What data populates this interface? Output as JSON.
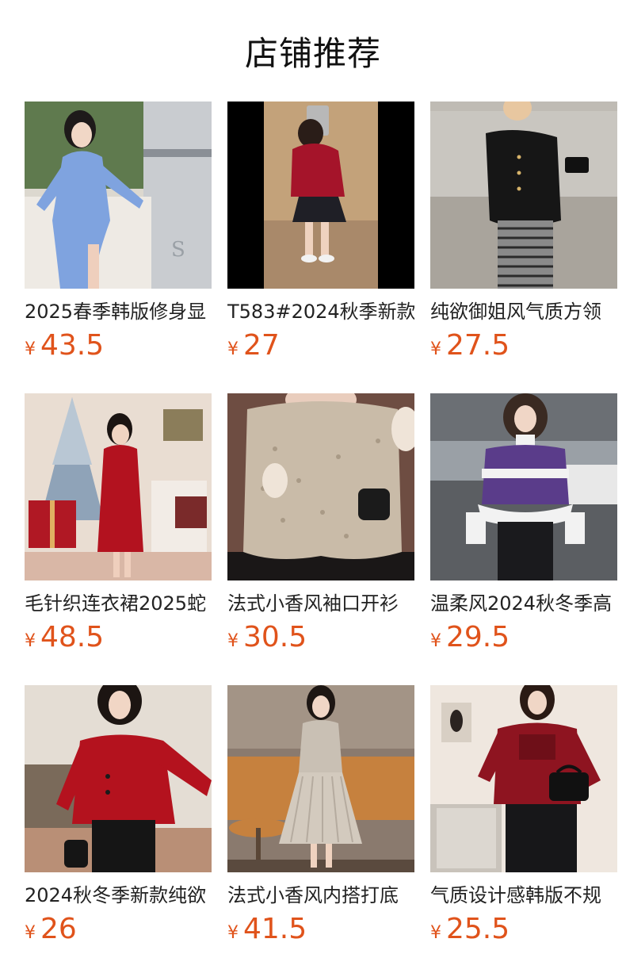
{
  "page": {
    "title": "店铺推荐",
    "currency_symbol": "¥",
    "accent_color": "#e0531b"
  },
  "products": [
    {
      "name": "2025春季韩版修身显",
      "price": "43.5",
      "image": "blue-knit-dress-photo"
    },
    {
      "name": "T583#2024秋季新款",
      "price": "27",
      "image": "red-sweater-mirror-selfie-photo"
    },
    {
      "name": "纯欲御姐风气质方领",
      "price": "27.5",
      "image": "black-cardigan-striped-pants-photo"
    },
    {
      "name": "毛针织连衣裙2025蛇",
      "price": "48.5",
      "image": "red-knit-dress-christmas-tree-photo"
    },
    {
      "name": "法式小香风袖口开衫",
      "price": "30.5",
      "image": "beige-fuzzy-cardigan-photo"
    },
    {
      "name": "温柔风2024秋冬季高",
      "price": "29.5",
      "image": "purple-white-sweater-snow-photo"
    },
    {
      "name": "2024秋冬季新款纯欲",
      "price": "26",
      "image": "red-halter-cardigan-photo"
    },
    {
      "name": "法式小香风内搭打底",
      "price": "41.5",
      "image": "grey-knit-pleated-dress-photo"
    },
    {
      "name": "气质设计感韩版不规",
      "price": "25.5",
      "image": "red-fur-trim-sweater-photo"
    }
  ]
}
